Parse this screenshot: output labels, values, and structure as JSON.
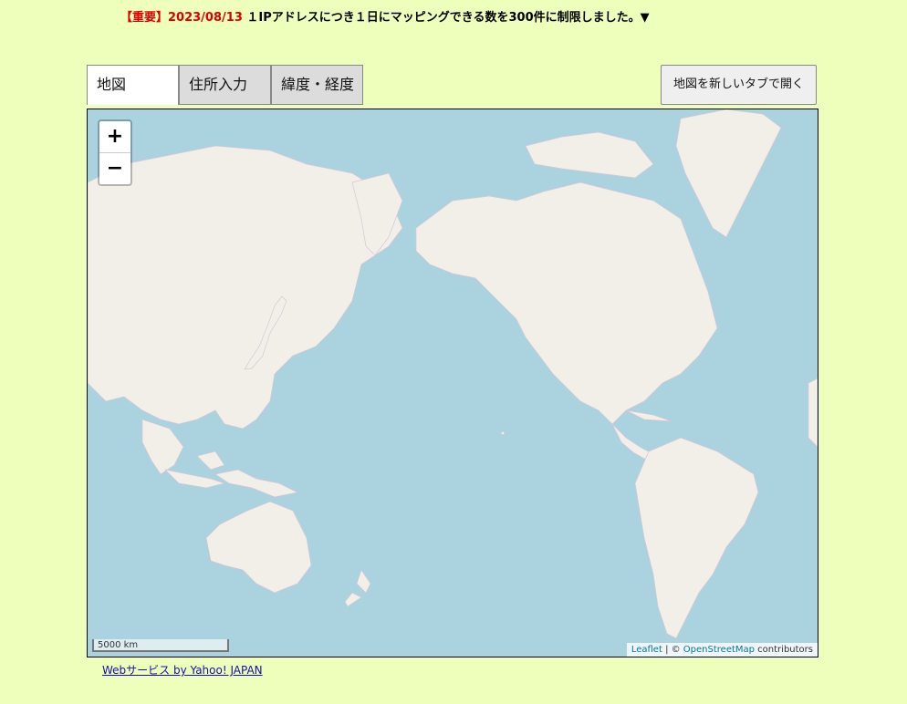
{
  "notice": {
    "tag": "【重要】2023/08/13",
    "text": "１IPアドレスにつき１日にマッピングできる数を300件に制限しました。▼"
  },
  "tabs": [
    {
      "label": "地図",
      "active": true
    },
    {
      "label": "住所入力",
      "active": false
    },
    {
      "label": "緯度・経度",
      "active": false
    }
  ],
  "open_new_tab_button": "地図を新しいタブで開く",
  "map": {
    "zoom_in": "+",
    "zoom_out": "−",
    "scale_label": "5000 km",
    "attribution": {
      "leaflet": "Leaflet",
      "separator": " | © ",
      "osm": "OpenStreetMap",
      "suffix": " contributors"
    },
    "colors": {
      "ocean": "#aad3df",
      "land": "#f2efe9",
      "border": "#c8b4c8"
    }
  },
  "footer_link": "Webサービス by Yahoo! JAPAN"
}
